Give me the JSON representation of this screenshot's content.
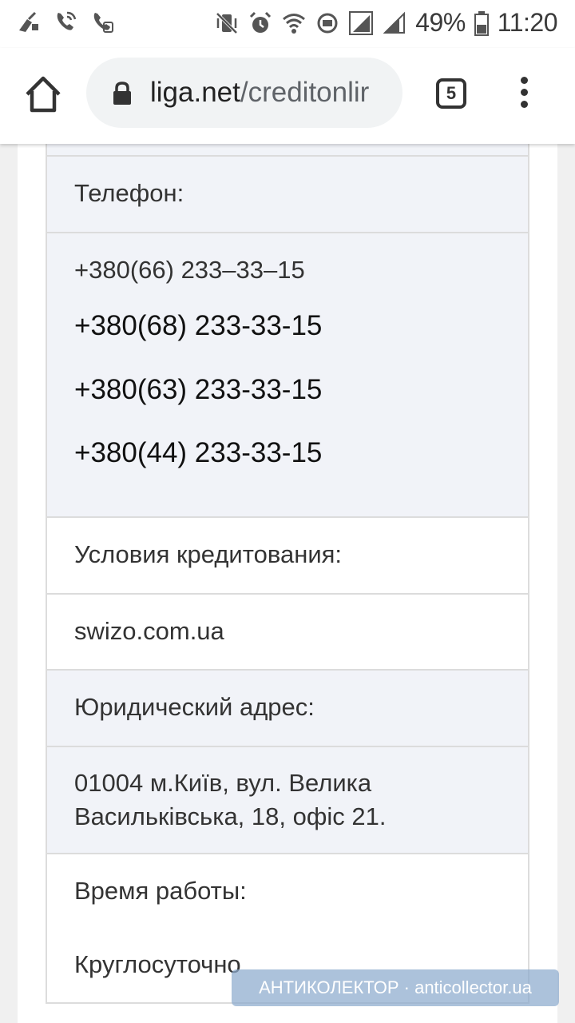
{
  "status_bar": {
    "battery_percent": "49%",
    "time": "11:20",
    "left_icons": [
      "broom-icon",
      "wifi-call-icon",
      "call-forward-icon"
    ],
    "right_icons": [
      "vibrate-icon",
      "alarm-icon",
      "wifi-icon",
      "vpn-icon",
      "signal-icon",
      "signal-icon",
      "battery-icon"
    ]
  },
  "browser": {
    "url_domain": "liga.net",
    "url_path": "/creditonlir",
    "tab_count": "5"
  },
  "table": {
    "phone_label": "Телефон:",
    "phones": [
      "+380(66) 233–33–15",
      "+380(68) 233-33-15",
      "+380(63) 233-33-15",
      "+380(44) 233-33-15"
    ],
    "terms_label": "Условия кредитования:",
    "terms_value": "swizo.com.ua",
    "address_label": "Юридический адрес:",
    "address_line1": "01004 м.Київ, вул. Велика",
    "address_line2": "Васильківська, 18, офіс 21.",
    "hours_label": "Время работы:",
    "hours_value": "Круглосуточно"
  },
  "watermark": "АНТИКОЛЕКТОР · anticollector.ua",
  "colors": {
    "row_shaded": "#f1f3f8",
    "border": "#dcdcdc",
    "url_bar": "#f1f3f4"
  }
}
